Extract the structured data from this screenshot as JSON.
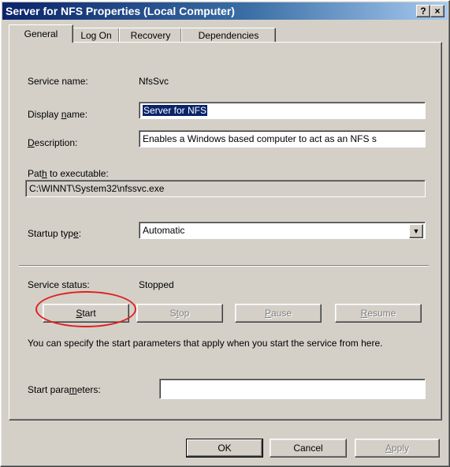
{
  "window": {
    "title": "Server for NFS Properties (Local Computer)",
    "help_glyph": "?",
    "close_glyph": "×"
  },
  "tabs": [
    {
      "label": "General",
      "active": true
    },
    {
      "label": "Log On",
      "active": false
    },
    {
      "label": "Recovery",
      "active": false
    },
    {
      "label": "Dependencies",
      "active": false
    }
  ],
  "general": {
    "service_name_label": "Service name:",
    "service_name_value": "NfsSvc",
    "display_name_label_pre": "Display ",
    "display_name_label_u": "n",
    "display_name_label_post": "ame:",
    "display_name_value": "Server for NFS",
    "description_label_u": "D",
    "description_label_post": "escription:",
    "description_value": "Enables a Windows based computer to act as an NFS s",
    "path_label_pre": "Pat",
    "path_label_u": "h",
    "path_label_post": " to executable:",
    "path_value": "C:\\WINNT\\System32\\nfssvc.exe",
    "startup_type_label_pre": "Startup typ",
    "startup_type_label_u": "e",
    "startup_type_label_post": ":",
    "startup_type_value": "Automatic",
    "service_status_label": "Service status:",
    "service_status_value": "Stopped",
    "buttons": {
      "start_u": "S",
      "start_post": "tart",
      "stop_pre": "S",
      "stop_u": "t",
      "stop_post": "op",
      "pause_u": "P",
      "pause_post": "ause",
      "resume_u": "R",
      "resume_post": "esume"
    },
    "hint_text": "You can specify the start parameters that apply when you start the service from here.",
    "start_params_label_pre": "Start para",
    "start_params_label_u": "m",
    "start_params_label_post": "eters:",
    "start_params_value": ""
  },
  "footer": {
    "ok_label": "OK",
    "cancel_label": "Cancel",
    "apply_u": "A",
    "apply_post": "pply"
  },
  "colors": {
    "face": "#d4d0c8",
    "title_start": "#0a246a",
    "annotation_circle": "#e02020"
  }
}
